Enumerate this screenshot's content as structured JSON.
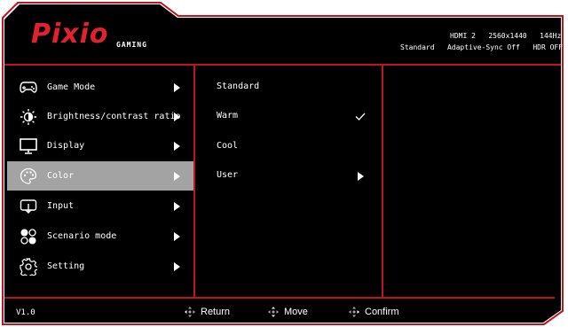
{
  "brand": {
    "logo": "Pixio",
    "sub": "GAMING"
  },
  "status": {
    "line1": [
      "HDMI 2",
      "2560x1440",
      "144Hz"
    ],
    "line2": [
      "Standard",
      "Adaptive-Sync Off",
      "HDR OFF"
    ]
  },
  "menu": [
    {
      "label": "Game Mode",
      "icon": "gamepad-icon"
    },
    {
      "label": "Brightness/contrast ratio",
      "icon": "brightness-icon"
    },
    {
      "label": "Display",
      "icon": "monitor-icon"
    },
    {
      "label": "Color",
      "icon": "palette-icon",
      "selected": true
    },
    {
      "label": "Input",
      "icon": "input-icon"
    },
    {
      "label": "Scenario mode",
      "icon": "scenario-icon"
    },
    {
      "label": "Setting",
      "icon": "gear-icon"
    }
  ],
  "submenu": [
    {
      "label": "Standard"
    },
    {
      "label": "Warm",
      "checked": true
    },
    {
      "label": "Cool"
    },
    {
      "label": "User",
      "has_arrow": true
    }
  ],
  "footer": {
    "version": "V1.0",
    "return_label": "Return",
    "move_label": "Move",
    "confirm_label": "Confirm"
  },
  "colors": {
    "accent": "#c0141e",
    "logo": "#e3212e",
    "selected_bg": "#a3a3a3"
  }
}
